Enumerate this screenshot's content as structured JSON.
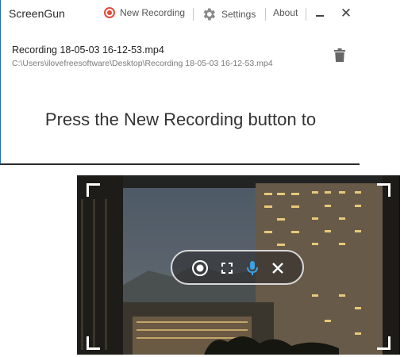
{
  "window": {
    "title": "ScreenGun",
    "new_recording_label": "New Recording",
    "settings_label": "Settings",
    "about_label": "About"
  },
  "recordings": [
    {
      "name": "Recording 18-05-03 16-12-53.mp4",
      "path": "C:\\Users\\ilovefreesoftware\\Desktop\\Recording 18-05-03 16-12-53.mp4"
    }
  ],
  "main": {
    "prompt": "Press the New Recording button to"
  },
  "colors": {
    "record_red": "#e24b3b",
    "mic_blue": "#3fa0e0",
    "window_border": "#1f6fb5"
  },
  "capture_toolbar": {
    "icons": [
      "record-icon",
      "fullscreen-icon",
      "microphone-icon",
      "close-icon"
    ]
  }
}
